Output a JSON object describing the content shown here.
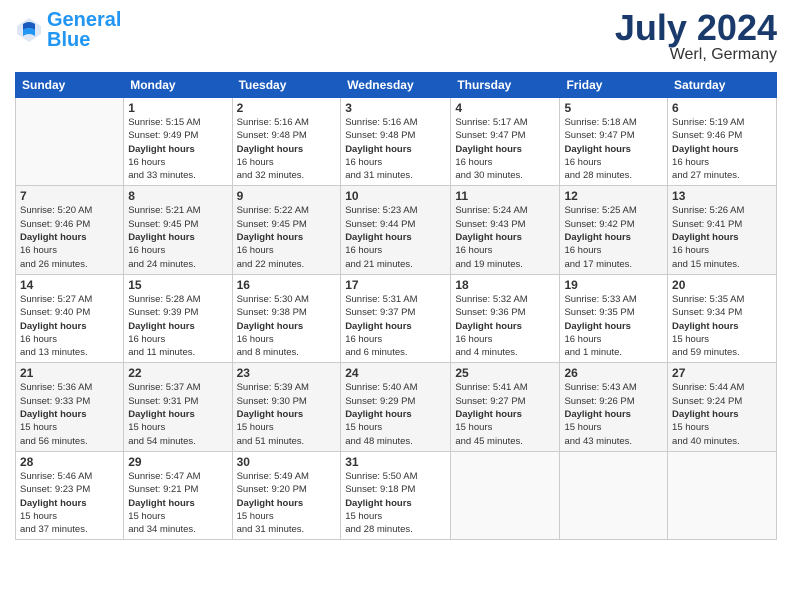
{
  "header": {
    "logo_general": "General",
    "logo_blue": "Blue",
    "month": "July 2024",
    "location": "Werl, Germany"
  },
  "days_of_week": [
    "Sunday",
    "Monday",
    "Tuesday",
    "Wednesday",
    "Thursday",
    "Friday",
    "Saturday"
  ],
  "weeks": [
    [
      {
        "day": "",
        "info": ""
      },
      {
        "day": "1",
        "info": "Sunrise: 5:15 AM\nSunset: 9:49 PM\nDaylight: 16 hours\nand 33 minutes."
      },
      {
        "day": "2",
        "info": "Sunrise: 5:16 AM\nSunset: 9:48 PM\nDaylight: 16 hours\nand 32 minutes."
      },
      {
        "day": "3",
        "info": "Sunrise: 5:16 AM\nSunset: 9:48 PM\nDaylight: 16 hours\nand 31 minutes."
      },
      {
        "day": "4",
        "info": "Sunrise: 5:17 AM\nSunset: 9:47 PM\nDaylight: 16 hours\nand 30 minutes."
      },
      {
        "day": "5",
        "info": "Sunrise: 5:18 AM\nSunset: 9:47 PM\nDaylight: 16 hours\nand 28 minutes."
      },
      {
        "day": "6",
        "info": "Sunrise: 5:19 AM\nSunset: 9:46 PM\nDaylight: 16 hours\nand 27 minutes."
      }
    ],
    [
      {
        "day": "7",
        "info": "Sunrise: 5:20 AM\nSunset: 9:46 PM\nDaylight: 16 hours\nand 26 minutes."
      },
      {
        "day": "8",
        "info": "Sunrise: 5:21 AM\nSunset: 9:45 PM\nDaylight: 16 hours\nand 24 minutes."
      },
      {
        "day": "9",
        "info": "Sunrise: 5:22 AM\nSunset: 9:45 PM\nDaylight: 16 hours\nand 22 minutes."
      },
      {
        "day": "10",
        "info": "Sunrise: 5:23 AM\nSunset: 9:44 PM\nDaylight: 16 hours\nand 21 minutes."
      },
      {
        "day": "11",
        "info": "Sunrise: 5:24 AM\nSunset: 9:43 PM\nDaylight: 16 hours\nand 19 minutes."
      },
      {
        "day": "12",
        "info": "Sunrise: 5:25 AM\nSunset: 9:42 PM\nDaylight: 16 hours\nand 17 minutes."
      },
      {
        "day": "13",
        "info": "Sunrise: 5:26 AM\nSunset: 9:41 PM\nDaylight: 16 hours\nand 15 minutes."
      }
    ],
    [
      {
        "day": "14",
        "info": "Sunrise: 5:27 AM\nSunset: 9:40 PM\nDaylight: 16 hours\nand 13 minutes."
      },
      {
        "day": "15",
        "info": "Sunrise: 5:28 AM\nSunset: 9:39 PM\nDaylight: 16 hours\nand 11 minutes."
      },
      {
        "day": "16",
        "info": "Sunrise: 5:30 AM\nSunset: 9:38 PM\nDaylight: 16 hours\nand 8 minutes."
      },
      {
        "day": "17",
        "info": "Sunrise: 5:31 AM\nSunset: 9:37 PM\nDaylight: 16 hours\nand 6 minutes."
      },
      {
        "day": "18",
        "info": "Sunrise: 5:32 AM\nSunset: 9:36 PM\nDaylight: 16 hours\nand 4 minutes."
      },
      {
        "day": "19",
        "info": "Sunrise: 5:33 AM\nSunset: 9:35 PM\nDaylight: 16 hours\nand 1 minute."
      },
      {
        "day": "20",
        "info": "Sunrise: 5:35 AM\nSunset: 9:34 PM\nDaylight: 15 hours\nand 59 minutes."
      }
    ],
    [
      {
        "day": "21",
        "info": "Sunrise: 5:36 AM\nSunset: 9:33 PM\nDaylight: 15 hours\nand 56 minutes."
      },
      {
        "day": "22",
        "info": "Sunrise: 5:37 AM\nSunset: 9:31 PM\nDaylight: 15 hours\nand 54 minutes."
      },
      {
        "day": "23",
        "info": "Sunrise: 5:39 AM\nSunset: 9:30 PM\nDaylight: 15 hours\nand 51 minutes."
      },
      {
        "day": "24",
        "info": "Sunrise: 5:40 AM\nSunset: 9:29 PM\nDaylight: 15 hours\nand 48 minutes."
      },
      {
        "day": "25",
        "info": "Sunrise: 5:41 AM\nSunset: 9:27 PM\nDaylight: 15 hours\nand 45 minutes."
      },
      {
        "day": "26",
        "info": "Sunrise: 5:43 AM\nSunset: 9:26 PM\nDaylight: 15 hours\nand 43 minutes."
      },
      {
        "day": "27",
        "info": "Sunrise: 5:44 AM\nSunset: 9:24 PM\nDaylight: 15 hours\nand 40 minutes."
      }
    ],
    [
      {
        "day": "28",
        "info": "Sunrise: 5:46 AM\nSunset: 9:23 PM\nDaylight: 15 hours\nand 37 minutes."
      },
      {
        "day": "29",
        "info": "Sunrise: 5:47 AM\nSunset: 9:21 PM\nDaylight: 15 hours\nand 34 minutes."
      },
      {
        "day": "30",
        "info": "Sunrise: 5:49 AM\nSunset: 9:20 PM\nDaylight: 15 hours\nand 31 minutes."
      },
      {
        "day": "31",
        "info": "Sunrise: 5:50 AM\nSunset: 9:18 PM\nDaylight: 15 hours\nand 28 minutes."
      },
      {
        "day": "",
        "info": ""
      },
      {
        "day": "",
        "info": ""
      },
      {
        "day": "",
        "info": ""
      }
    ]
  ]
}
